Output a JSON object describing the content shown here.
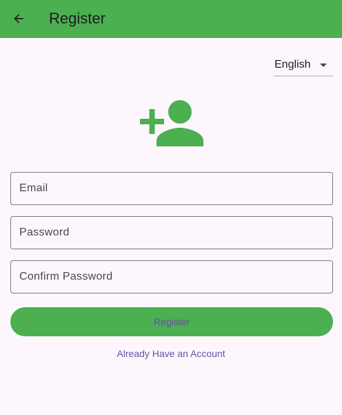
{
  "app_bar": {
    "title": "Register",
    "back_icon": "arrow-back-icon",
    "background_color": "#4caf50"
  },
  "language": {
    "selected": "English"
  },
  "hero": {
    "icon": "person-add-icon",
    "color": "#4caf50"
  },
  "form": {
    "email_placeholder": "Email",
    "password_placeholder": "Password",
    "confirm_password_placeholder": "Confirm Password",
    "register_label": "Register",
    "login_link_label": "Already Have an Account"
  },
  "colors": {
    "accent": "#4caf50",
    "link_text": "#6750a4",
    "background": "#fdf7fd"
  }
}
